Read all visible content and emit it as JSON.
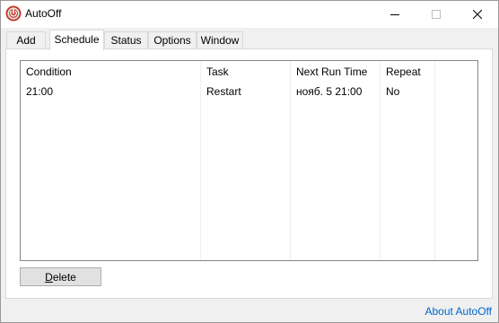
{
  "window": {
    "title": "AutoOff",
    "controls": {
      "minimize": "—",
      "maximize": "☐",
      "close": "✕"
    }
  },
  "tabs": [
    {
      "label": "Add",
      "active": false
    },
    {
      "label": "Schedule",
      "active": true
    },
    {
      "label": "Status",
      "active": false
    },
    {
      "label": "Options",
      "active": false
    },
    {
      "label": "Window",
      "active": false
    }
  ],
  "schedule": {
    "columns": [
      "Condition",
      "Task",
      "Next Run Time",
      "Repeat"
    ],
    "rows": [
      [
        "21:00",
        "Restart",
        "нояб. 5 21:00",
        "No"
      ]
    ],
    "delete_label": "Delete",
    "delete_mnemonic": "D",
    "delete_rest": "elete"
  },
  "footer": {
    "about_label": "About AutoOff"
  },
  "colors": {
    "link": "#0066cc",
    "icon_red": "#c0392b"
  },
  "icons": {
    "app": "power-icon"
  }
}
